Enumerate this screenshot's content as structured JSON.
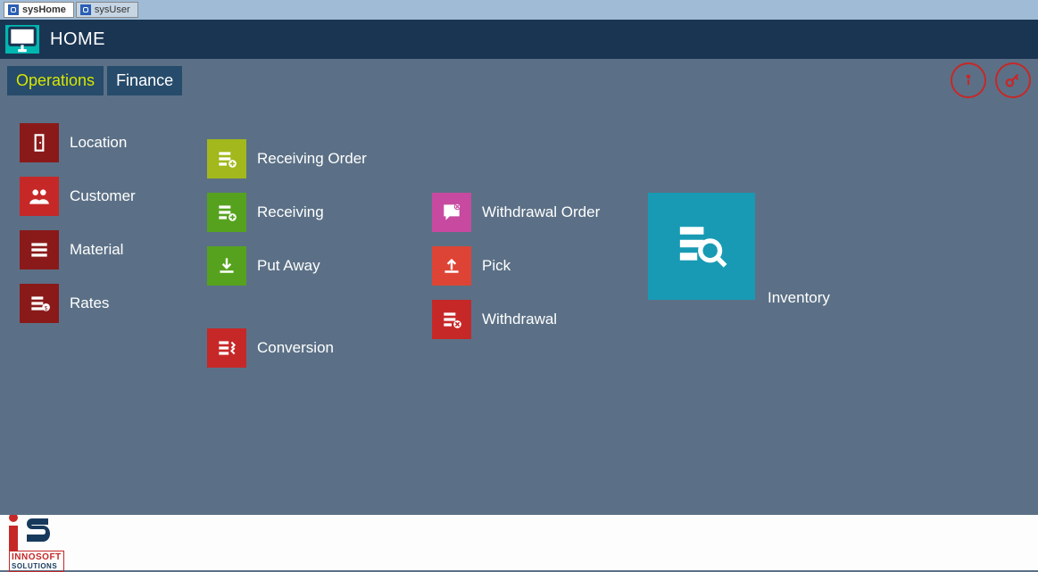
{
  "window": {
    "tabs": [
      {
        "label": "sysHome",
        "active": true
      },
      {
        "label": "sysUser",
        "active": false
      }
    ]
  },
  "header": {
    "title": "HOME"
  },
  "toolbar": {
    "tabs": [
      {
        "label": "Operations",
        "active": true
      },
      {
        "label": "Finance",
        "active": false
      }
    ]
  },
  "tiles": {
    "col1": [
      {
        "id": "location",
        "label": "Location",
        "color": "#8a1a1a",
        "icon": "door"
      },
      {
        "id": "customer",
        "label": "Customer",
        "color": "#c62828",
        "icon": "users"
      },
      {
        "id": "material",
        "label": "Material",
        "color": "#8a1a1a",
        "icon": "list"
      },
      {
        "id": "rates",
        "label": "Rates",
        "color": "#8a1a1a",
        "icon": "money"
      }
    ],
    "col2": [
      {
        "id": "receiving-order",
        "label": "Receiving Order",
        "color": "#a2b81c",
        "icon": "list-add"
      },
      {
        "id": "receiving",
        "label": "Receiving",
        "color": "#56a21e",
        "icon": "list-add"
      },
      {
        "id": "put-away",
        "label": "Put Away",
        "color": "#56a21e",
        "icon": "download"
      },
      {
        "id": "conversion",
        "label": "Conversion",
        "color": "#c62828",
        "icon": "swap"
      }
    ],
    "col3": [
      {
        "id": "withdrawal-order",
        "label": "Withdrawal Order",
        "color": "#c74aa0",
        "icon": "chat"
      },
      {
        "id": "pick",
        "label": "Pick",
        "color": "#de4435",
        "icon": "upload"
      },
      {
        "id": "withdrawal",
        "label": "Withdrawal",
        "color": "#c62828",
        "icon": "list-remove"
      }
    ],
    "big": {
      "id": "inventory",
      "label": "Inventory",
      "color": "#189ab4",
      "icon": "search-list"
    }
  },
  "footer": {
    "brand1": "INNOSOFT",
    "brand2": "SOLUTIONS"
  }
}
